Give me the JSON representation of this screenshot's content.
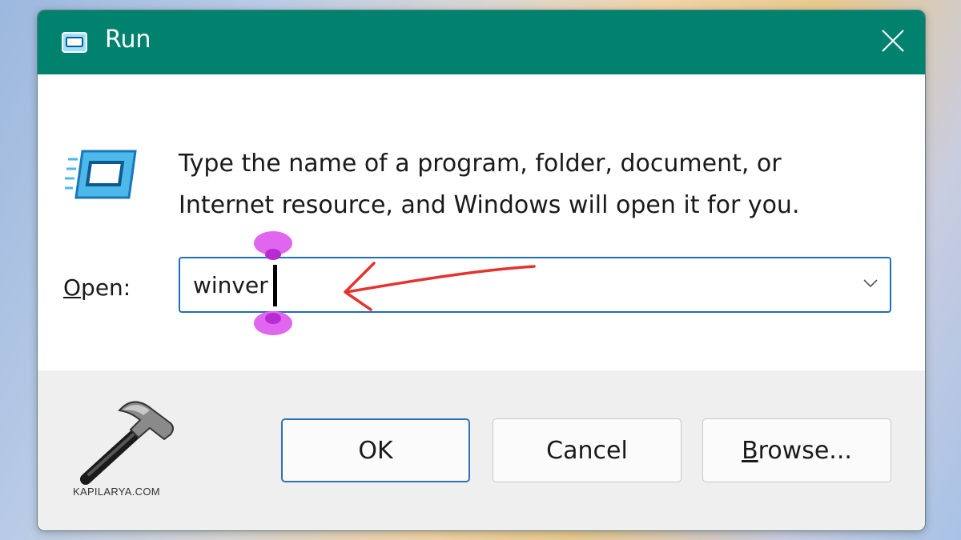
{
  "window": {
    "title": "Run",
    "close_icon": "close-icon",
    "title_icon": "run-app-icon"
  },
  "content": {
    "description_line1": "Type the name of a program, folder, document, or",
    "description_line2": "Internet resource, and Windows will open it for you.",
    "open_label_accel": "O",
    "open_label_rest": "pen:",
    "open_value": "winver",
    "dropdown_icon": "chevron-down-icon"
  },
  "buttons": {
    "ok_label": "OK",
    "cancel_label": "Cancel",
    "browse_accel": "B",
    "browse_rest": "rowse..."
  },
  "watermark": {
    "text": "KAPILARYA.COM",
    "icon": "hammer-logo-icon"
  },
  "colors": {
    "titlebar": "#00826f",
    "accent": "#1e6fb8",
    "annotation_arrow": "#e5322f",
    "cursor_handles": "#e066f0"
  }
}
